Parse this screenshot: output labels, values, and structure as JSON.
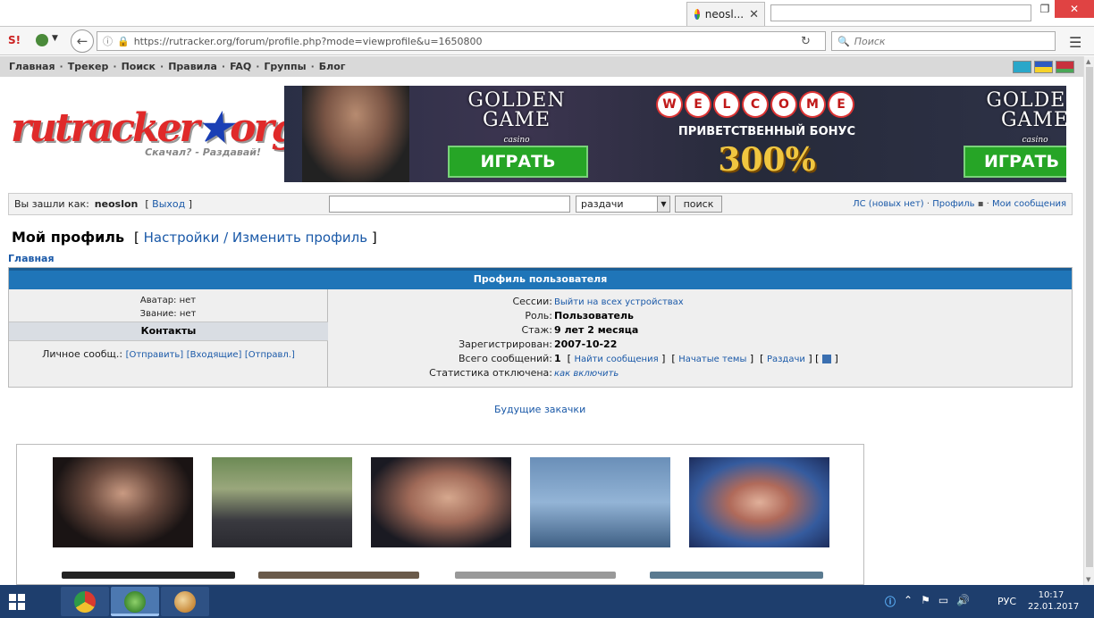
{
  "browser": {
    "tab_title": "neosl...",
    "url": "https://rutracker.org/forum/profile.php?mode=viewprofile&u=1650800",
    "search_placeholder": "Поиск",
    "addon_label": "S!"
  },
  "site_menu": [
    "Главная",
    "Трекер",
    "Поиск",
    "Правила",
    "FAQ",
    "Группы",
    "Блог"
  ],
  "logo": {
    "text_a": "rutracker",
    "text_b": "org",
    "slogan": "Скачал? - Раздавай!"
  },
  "banner": {
    "brand": "GOLDEN GAME",
    "brand_sub": "casino",
    "welcome_letters": [
      "W",
      "E",
      "L",
      "C",
      "O",
      "M",
      "E"
    ],
    "bonus_text": "ПРИВЕТСТВЕННЫЙ БОНУС",
    "bonus_percent": "300%",
    "play_label": "ИГРАТЬ"
  },
  "login": {
    "prefix": "Вы зашли как:",
    "username": "neoslon",
    "logout_label": "Выход",
    "search_select": "раздачи",
    "search_button": "поиск",
    "pm_link": "ЛС (новых нет)",
    "profile_link": "Профиль",
    "my_posts_link": "Мои сообщения"
  },
  "profile": {
    "title": "Мой профиль",
    "settings_link": "Настройки / Изменить профиль",
    "breadcrumb": "Главная",
    "table_header": "Профиль пользователя",
    "avatar": "Аватар: нет",
    "rank": "Звание: нет",
    "contacts_header": "Контакты",
    "pm_label": "Личное сообщ.:",
    "pm_send": "[Отправить]",
    "pm_inbox": "[Входящие]",
    "pm_sent": "[Отправл.]",
    "rows": {
      "sessions_label": "Сессии:",
      "sessions_value": "Выйти на всех устройствах",
      "role_label": "Роль:",
      "role_value": "Пользователь",
      "tenure_label": "Стаж:",
      "tenure_value": "9 лет 2 месяца",
      "registered_label": "Зарегистрирован:",
      "registered_value": "2007-10-22",
      "posts_label": "Всего сообщений:",
      "posts_value": "1",
      "find_posts": "Найти сообщения",
      "started_topics": "Начатые темы",
      "releases": "Раздачи",
      "stats_label": "Статистика отключена:",
      "stats_value": "как включить"
    }
  },
  "future_downloads": "Будущие закачки",
  "taskbar": {
    "lang": "РУС",
    "time": "10:17",
    "date": "22.01.2017"
  }
}
